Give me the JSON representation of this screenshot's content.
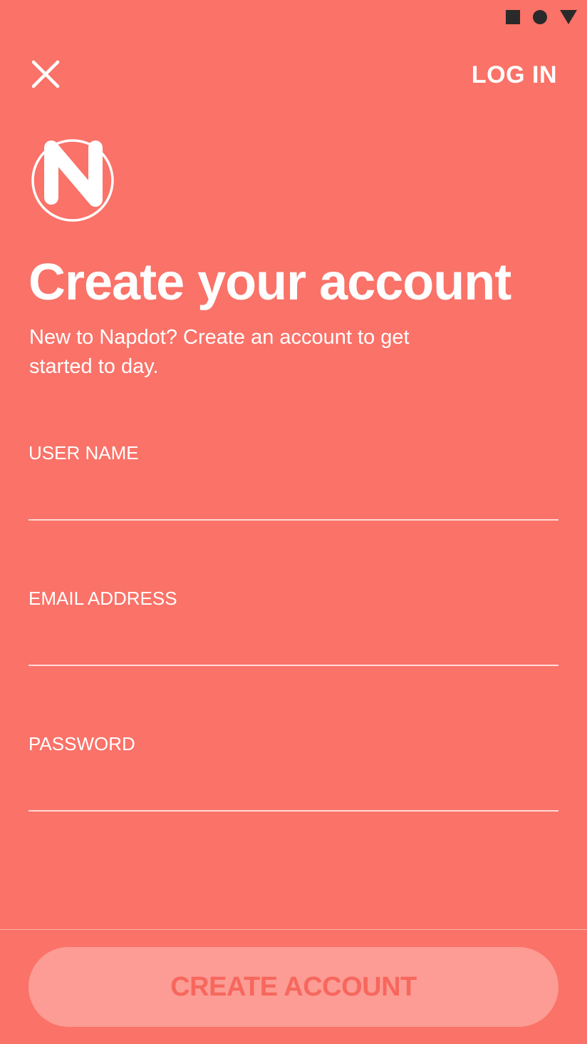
{
  "status_bar": {
    "icons": [
      "stop-square-icon",
      "record-circle-icon",
      "signal-triangle-icon"
    ]
  },
  "header": {
    "close_icon": "close-icon",
    "login_label": "LOG IN"
  },
  "logo": {
    "letter": "N"
  },
  "main": {
    "title": "Create your account",
    "subtitle": "New to Napdot? Create an account to get started to day."
  },
  "form": {
    "username": {
      "label": "USER NAME",
      "value": "",
      "placeholder": ""
    },
    "email": {
      "label": "EMAIL ADDRESS",
      "value": "",
      "placeholder": ""
    },
    "password": {
      "label": "PASSWORD",
      "value": "",
      "placeholder": ""
    }
  },
  "footer": {
    "create_account_label": "CREATE ACCOUNT"
  },
  "colors": {
    "background": "#FA7268",
    "button_background": "#FC9C94",
    "button_text": "#F7675D",
    "foreground": "#FFFFFF",
    "status_icons": "#2A2A2A"
  }
}
